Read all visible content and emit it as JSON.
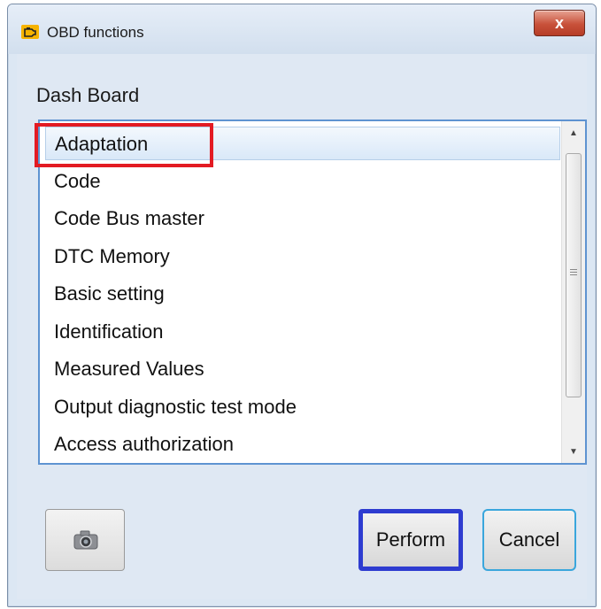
{
  "window": {
    "title": "OBD functions",
    "close_label": "x"
  },
  "group": {
    "label": "Dash Board"
  },
  "list": {
    "items": [
      "Adaptation",
      "Code",
      "Code Bus master",
      "DTC Memory",
      "Basic setting",
      "Identification",
      "Measured Values",
      "Output diagnostic test mode",
      "Access authorization"
    ],
    "selected_item": "Adaptation"
  },
  "buttons": {
    "perform_label": "Perform",
    "cancel_label": "Cancel"
  },
  "colors": {
    "highlight_red": "#e31b23",
    "highlight_blue": "#2e3cd0",
    "list_border": "#5e93d1"
  },
  "icons": {
    "app": "engine-icon",
    "camera": "camera-icon"
  }
}
